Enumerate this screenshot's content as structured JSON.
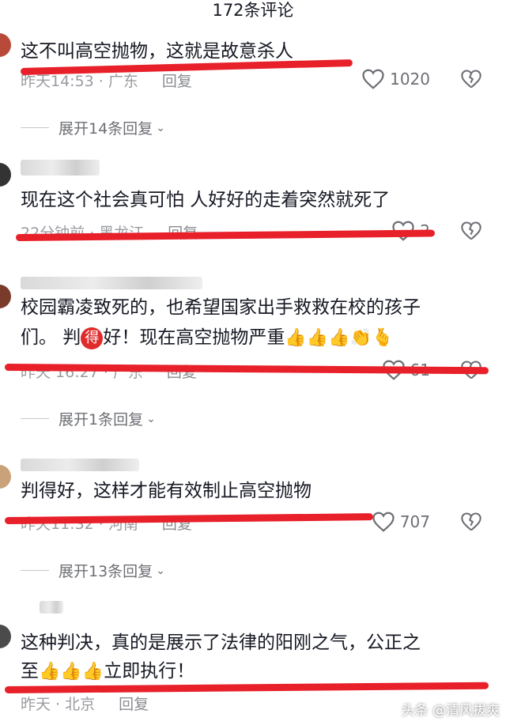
{
  "header": {
    "title": "172条评论"
  },
  "comments": [
    {
      "text": "这不叫高空抛物，这就是故意杀人",
      "meta": "昨天14:53 · 广东",
      "reply": "回复",
      "likes": "1020",
      "expand": "展开14条回复"
    },
    {
      "text": "现在这个社会真可怕 人好好的走着突然就死了",
      "meta": "22分钟前 · 黑龙江",
      "reply": "回复",
      "likes": "2"
    },
    {
      "text_line1": "校园霸凌致死的，也希望国家出手救救在校的孩子",
      "text_line2a": "们。 判",
      "text_de": "得",
      "text_line2b": "好！现在高空抛物严重",
      "meta": "昨天 16:27 · 广东",
      "reply": "回复",
      "likes": "61",
      "expand": "展开1条回复"
    },
    {
      "text": "判得好，这样才能有效制止高空抛物",
      "meta": "昨天11:32 · 河南",
      "reply": "回复",
      "likes": "707",
      "expand": "展开13条回复"
    },
    {
      "text_line1": "这种判决，真的是展示了法律的阳刚之气，公正之",
      "text_line2a": "至",
      "text_line2b": "立即执行！",
      "meta": "昨天 · 北京",
      "reply": "回复"
    }
  ],
  "icons": {
    "like": "heart-outline-icon",
    "dislike": "broken-heart-icon",
    "thumbs": "thumbs-up-emoji",
    "clap": "clap-emoji",
    "finger_heart": "finger-heart-emoji"
  },
  "watermark": "头条 @清风拔爽",
  "colors": {
    "annotation": "#e8202a",
    "text": "#161823",
    "meta": "#9a9ba0"
  }
}
